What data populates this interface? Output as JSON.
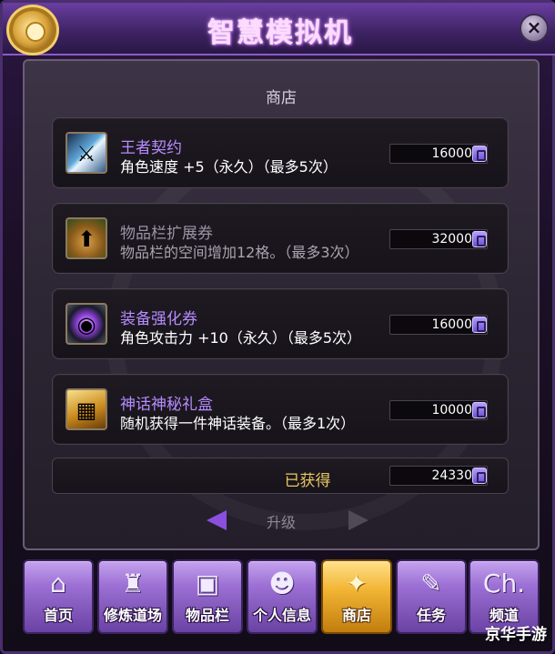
{
  "window": {
    "title": "智慧模拟机",
    "close_glyph": "×"
  },
  "shop": {
    "title": "商店",
    "items": [
      {
        "name": "王者契约",
        "desc": "角色速度 +5（永久）（最多5次）",
        "price": "16000",
        "icon": "sword-icon",
        "dim": false
      },
      {
        "name": "物品栏扩展券",
        "desc": "物品栏的空间增加12格。（最多3次）",
        "price": "32000",
        "icon": "bag-icon",
        "dim": true
      },
      {
        "name": "装备强化券",
        "desc": "角色攻击力 +10（永久）（最多5次）",
        "price": "16000",
        "icon": "gem-icon",
        "dim": false
      },
      {
        "name": "神话神秘礼盒",
        "desc": "随机获得一件神话装备。（最多1次）",
        "price": "10000",
        "icon": "chest-icon",
        "dim": false
      }
    ],
    "obtained_label": "已获得",
    "obtained_value": "24330",
    "upgrade_label": "升级"
  },
  "nav": [
    {
      "label": "首页",
      "icon": "home-icon",
      "glyph": "⌂",
      "active": false
    },
    {
      "label": "修炼道场",
      "icon": "dojo-icon",
      "glyph": "♜",
      "active": false
    },
    {
      "label": "物品栏",
      "icon": "inventory-icon",
      "glyph": "▣",
      "active": false
    },
    {
      "label": "个人信息",
      "icon": "profile-icon",
      "glyph": "☻",
      "active": false
    },
    {
      "label": "商店",
      "icon": "shop-icon",
      "glyph": "✦",
      "active": true
    },
    {
      "label": "任务",
      "icon": "quest-scroll-icon",
      "glyph": "✎",
      "active": false
    },
    {
      "label": "频道",
      "icon": "channel-icon",
      "glyph": "Ch.",
      "active": false
    }
  ],
  "watermark": "京华手游",
  "colors": {
    "accent": "#b68cff",
    "gold": "#e9c860",
    "active_tab": "#f2b534"
  }
}
